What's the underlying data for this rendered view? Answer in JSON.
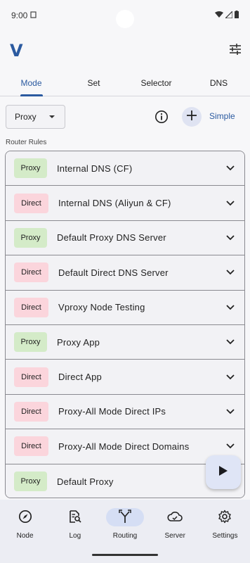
{
  "status_bar": {
    "time": "9:00"
  },
  "app": {
    "logo": "V"
  },
  "tabs": [
    {
      "label": "Mode",
      "active": true
    },
    {
      "label": "Set",
      "active": false
    },
    {
      "label": "Selector",
      "active": false
    },
    {
      "label": "DNS",
      "active": false
    }
  ],
  "toolbar": {
    "mode_value": "Proxy",
    "simple_label": "Simple"
  },
  "section_label": "Router Rules",
  "rules": [
    {
      "badge": "Proxy",
      "type": "proxy",
      "name": "Internal DNS (CF)"
    },
    {
      "badge": "Direct",
      "type": "direct",
      "name": "Internal DNS (Aliyun & CF)"
    },
    {
      "badge": "Proxy",
      "type": "proxy",
      "name": "Default Proxy DNS Server"
    },
    {
      "badge": "Direct",
      "type": "direct",
      "name": "Default Direct DNS Server"
    },
    {
      "badge": "Direct",
      "type": "direct",
      "name": "Vproxy Node Testing"
    },
    {
      "badge": "Proxy",
      "type": "proxy",
      "name": "Proxy App"
    },
    {
      "badge": "Direct",
      "type": "direct",
      "name": "Direct App"
    },
    {
      "badge": "Direct",
      "type": "direct",
      "name": "Proxy-All Mode Direct IPs"
    },
    {
      "badge": "Direct",
      "type": "direct",
      "name": "Proxy-All Mode Direct Domains"
    },
    {
      "badge": "Proxy",
      "type": "proxy",
      "name": "Default Proxy"
    }
  ],
  "bottom_nav": [
    {
      "label": "Node",
      "icon": "compass-icon",
      "active": false
    },
    {
      "label": "Log",
      "icon": "log-search-icon",
      "active": false
    },
    {
      "label": "Routing",
      "icon": "routing-icon",
      "active": true
    },
    {
      "label": "Server",
      "icon": "cloud-icon",
      "active": false
    },
    {
      "label": "Settings",
      "icon": "gear-icon",
      "active": false
    }
  ],
  "colors": {
    "accent": "#2b5aa0",
    "proxy_badge": "#d4ebc8",
    "direct_badge": "#fbd5dc"
  }
}
